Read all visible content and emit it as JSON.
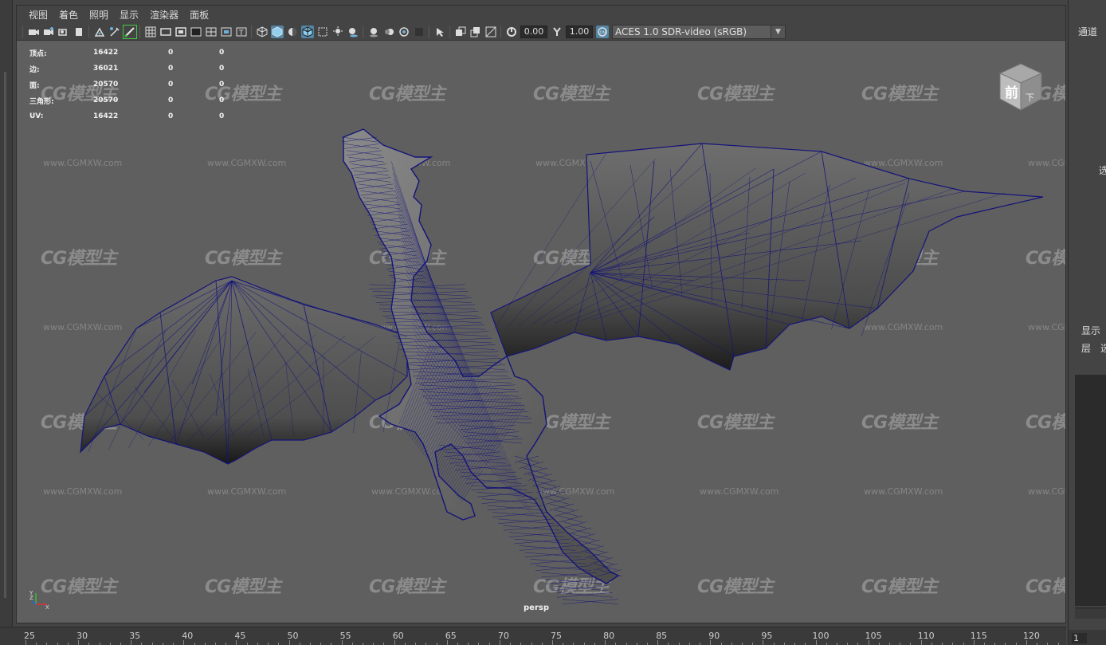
{
  "menu": [
    "视图",
    "着色",
    "照明",
    "显示",
    "渲染器",
    "面板"
  ],
  "toolbar": {
    "exposure_value": "0.00",
    "gamma_value": "1.00",
    "color_space": "ACES 1.0 SDR-video (sRGB)"
  },
  "hud": {
    "rows": [
      {
        "label": "顶点:",
        "v1": "16422",
        "v2": "0",
        "v3": "0"
      },
      {
        "label": "边:",
        "v1": "36021",
        "v2": "0",
        "v3": "0"
      },
      {
        "label": "面:",
        "v1": "20570",
        "v2": "0",
        "v3": "0"
      },
      {
        "label": "三角形:",
        "v1": "20570",
        "v2": "0",
        "v3": "0"
      },
      {
        "label": "UV:",
        "v1": "16422",
        "v2": "0",
        "v3": "0"
      }
    ]
  },
  "viewport": {
    "camera_label": "persp",
    "view_cube_front": "前",
    "view_cube_bottom": "下",
    "axis_labels": [
      "Y",
      "Z",
      "X"
    ]
  },
  "watermark": {
    "logo_text": "CG模型主",
    "url_text": "www.CGMXW.com"
  },
  "timeline": {
    "ticks": [
      "25",
      "30",
      "35",
      "40",
      "45",
      "50",
      "55",
      "60",
      "65",
      "70",
      "75",
      "80",
      "85",
      "90",
      "95",
      "100",
      "105",
      "110",
      "115",
      "120"
    ]
  },
  "right_panel": {
    "channel_label": "通道",
    "select_label": "选",
    "display_label": "显示",
    "layer_label": "层",
    "tab2_label": "选",
    "bottom_value": "1"
  },
  "colors": {
    "viewport_bg": "#5f5f5f",
    "wireframe": "#14147a",
    "accent": "#5285a6"
  }
}
